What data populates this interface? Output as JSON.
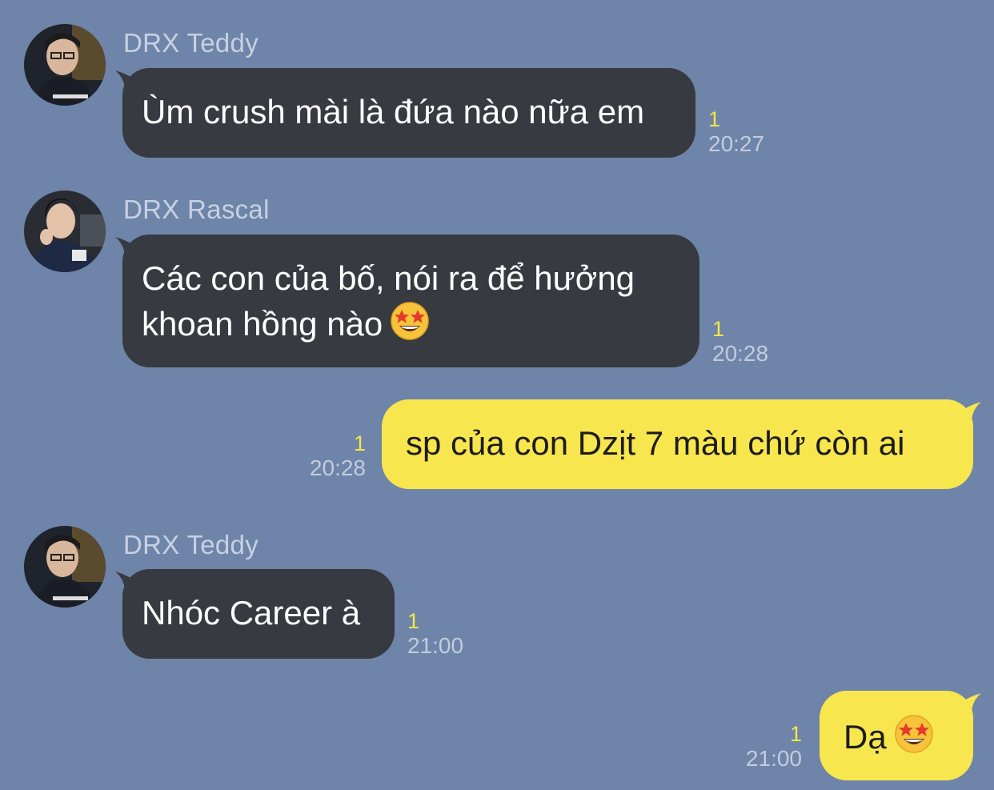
{
  "messages": [
    {
      "sender": "DRX Teddy",
      "text": "Ùm crush mài là đứa nào nữa em",
      "unread": "1",
      "time": "20:27",
      "avatar_icon": "teddy-avatar"
    },
    {
      "sender": "DRX Rascal",
      "text_line1": "Các con của bố, nói ra để hưởng",
      "text_line2": "khoan hồng nào",
      "emoji": "star-struck-emoji",
      "unread": "1",
      "time": "20:28",
      "avatar_icon": "rascal-avatar"
    },
    {
      "sender": "me",
      "text": "sp của con Dzịt 7 màu chứ còn ai",
      "unread": "1",
      "time": "20:28"
    },
    {
      "sender": "DRX Teddy",
      "text": "Nhóc Career à",
      "unread": "1",
      "time": "21:00",
      "avatar_icon": "teddy-avatar"
    },
    {
      "sender": "me",
      "text": "Dạ",
      "emoji": "star-struck-emoji",
      "unread": "1",
      "time": "21:00"
    }
  ],
  "colors": {
    "background": "#6e84a9",
    "incoming_bubble": "#373a40",
    "outgoing_bubble": "#f8e64e",
    "unread_count": "#f5e54a",
    "timestamp": "#c2ccdd"
  }
}
